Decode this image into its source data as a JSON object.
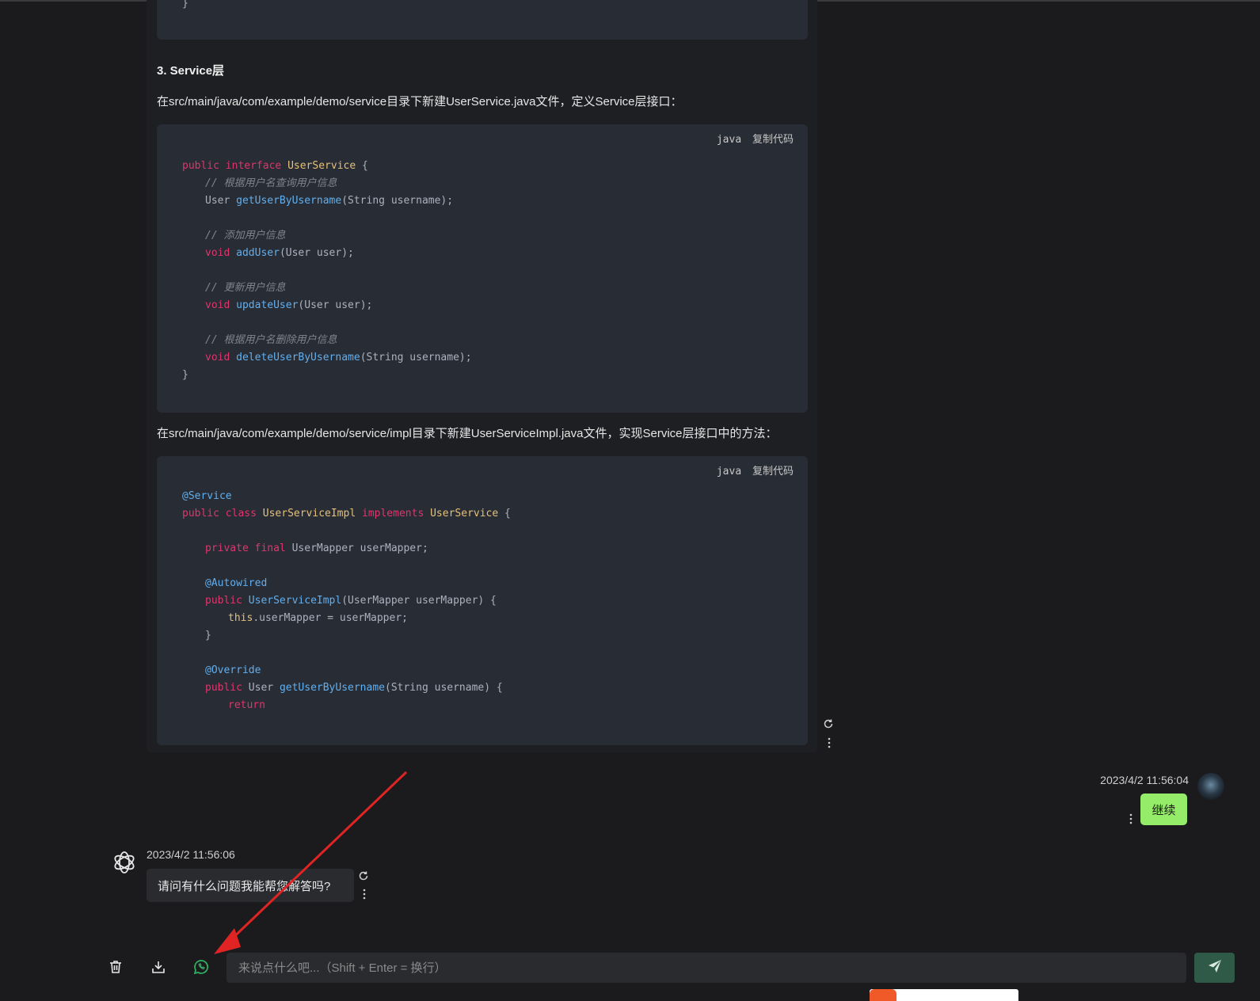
{
  "thread": {
    "section_heading": "3. Service层",
    "intro_interface": "在src/main/java/com/example/demo/service目录下新建UserService.java文件，定义Service层接口：",
    "intro_impl": "在src/main/java/com/example/demo/service/impl目录下新建UserServiceImpl.java文件，实现Service层接口中的方法：",
    "prev_code_tail": "}",
    "code_blocks": [
      {
        "lang": "java",
        "copy_label": "复制代码"
      },
      {
        "lang": "java",
        "copy_label": "复制代码"
      }
    ]
  },
  "code1": {
    "kw_public": "public",
    "kw_interface": "interface",
    "type_userservice": "UserService",
    "brace_open": " {",
    "c1": "// 根据用户名查询用户信息",
    "l2_type": "User ",
    "l2_fn": "getUserByUsername",
    "l2_rest": "(String username);",
    "c2": "// 添加用户信息",
    "kw_void": "void",
    "l4_fn": "addUser",
    "l4_rest": "(User user);",
    "c3": "// 更新用户信息",
    "l6_fn": "updateUser",
    "l6_rest": "(User user);",
    "c4": "// 根据用户名删除用户信息",
    "l8_fn": "deleteUserByUsername",
    "l8_rest": "(String username);",
    "brace_close": "}"
  },
  "code2": {
    "ann_service": "@Service",
    "kw_public": "public",
    "kw_class": "class",
    "type_impl": "UserServiceImpl",
    "kw_implements": "implements",
    "type_iface": "UserService",
    "brace_open": " {",
    "kw_private": "private",
    "kw_final": "final",
    "field_decl": "UserMapper userMapper;",
    "ann_autowired": "@Autowired",
    "ctor_fn": "UserServiceImpl",
    "ctor_rest": "(UserMapper userMapper) {",
    "kw_this": "this",
    "assign_rest": ".userMapper = userMapper;",
    "close_brace": "}",
    "ann_override": "@Override",
    "m_type": "User ",
    "m_fn": "getUserByUsername",
    "m_rest": "(String username) {",
    "kw_return": "return"
  },
  "user_msg": {
    "time": "2023/4/2 11:56:04",
    "text": "继续"
  },
  "ai_msg": {
    "time": "2023/4/2 11:56:06",
    "text": "请问有什么问题我能帮您解答吗?"
  },
  "input": {
    "placeholder": "来说点什么吧...（Shift + Enter = 换行）",
    "value": ""
  },
  "icons": {
    "toolbar": [
      "trash-icon",
      "download-icon",
      "whatsapp-icon",
      "send-icon"
    ],
    "message_actions": [
      "refresh-icon",
      "more-vertical-icon"
    ]
  },
  "colors": {
    "background": "#1b1b1d",
    "code_bg": "#282c34",
    "user_bubble": "#95ec69",
    "send_button": "#2f5a48",
    "annotation_arrow": "#e02424",
    "whatsapp_icon": "#2fb463"
  }
}
